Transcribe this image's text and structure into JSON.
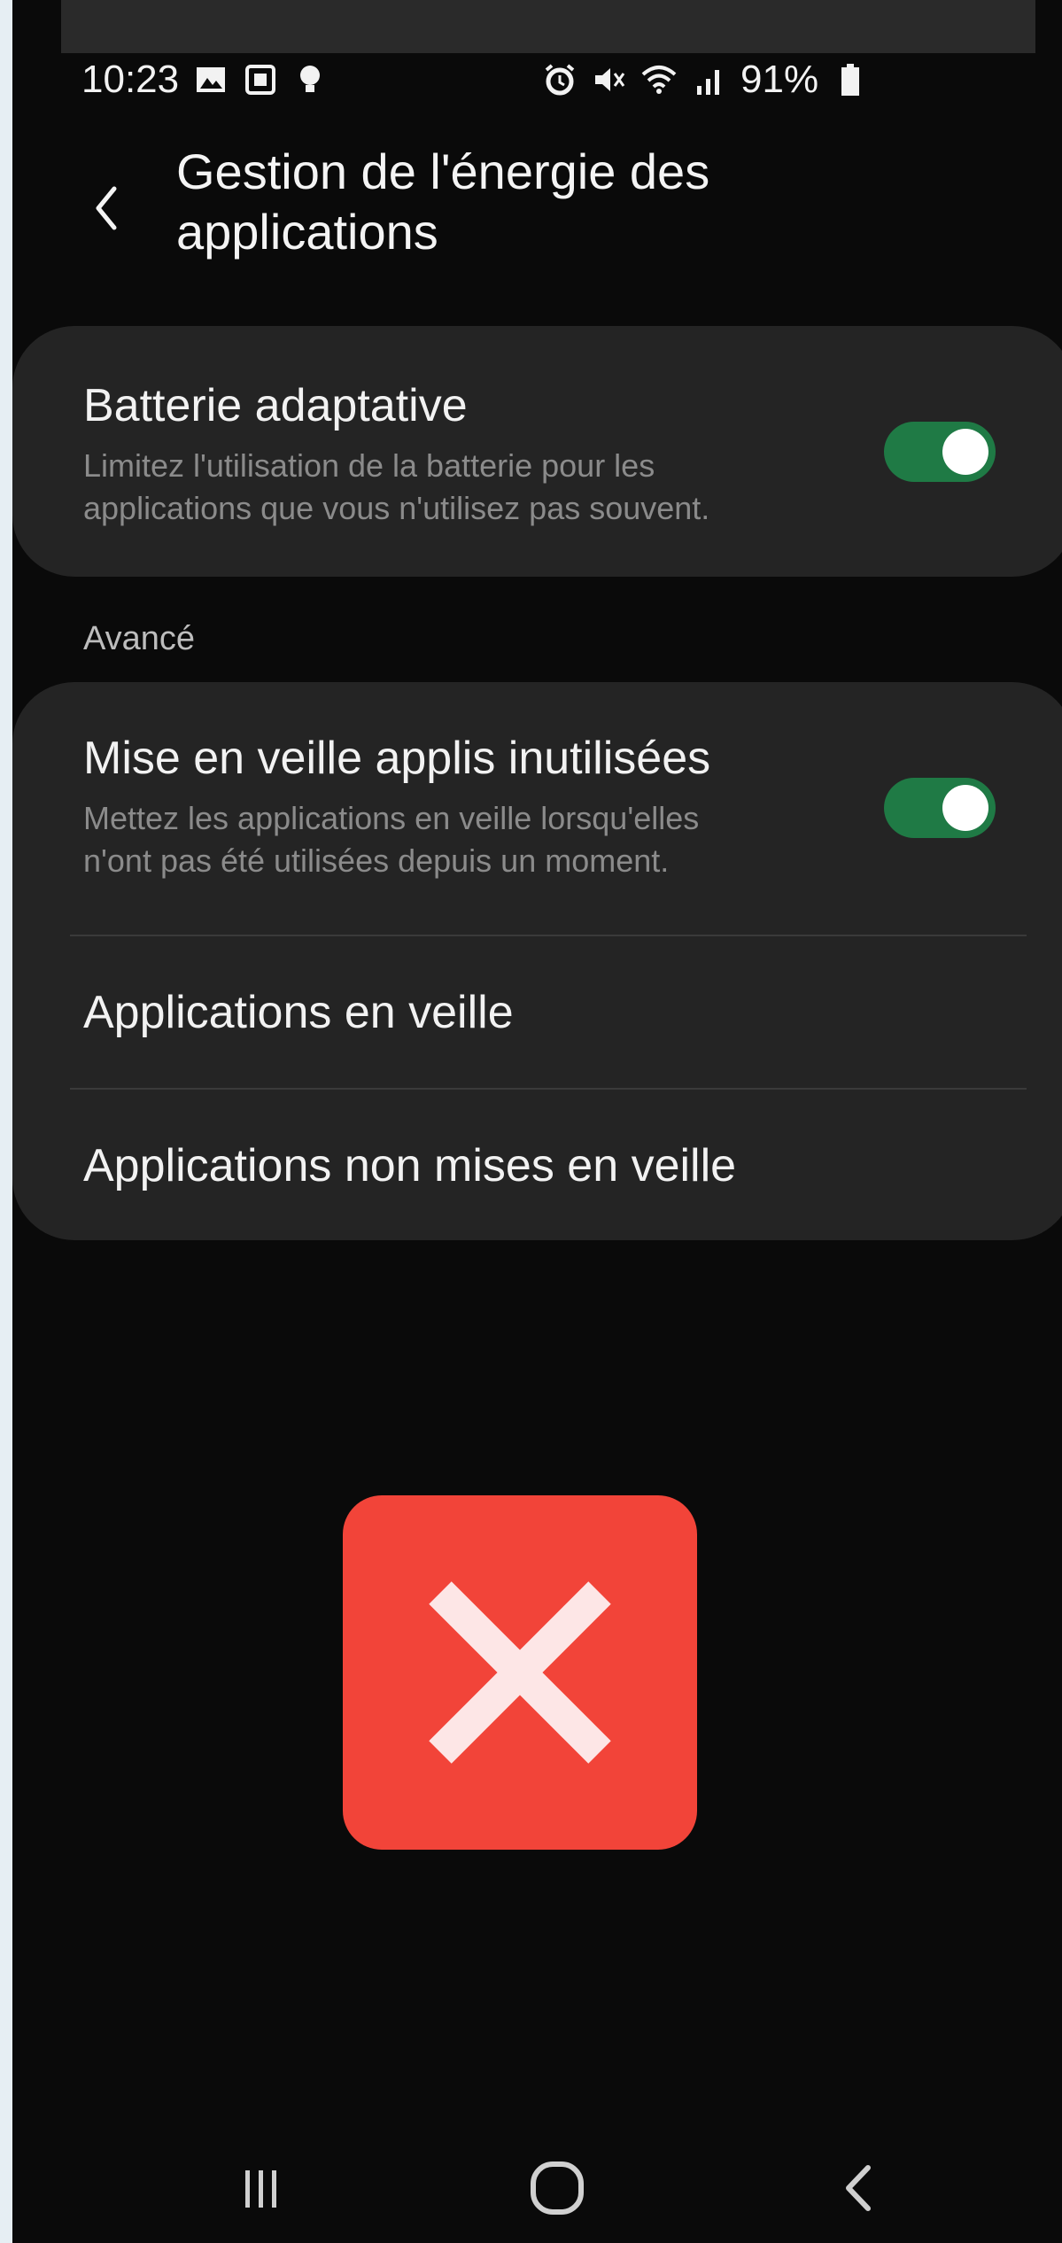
{
  "status_bar": {
    "time": "10:23",
    "battery_percent": "91%",
    "icons": [
      "gallery-icon",
      "screenshot-icon",
      "bulb-icon",
      "alarm-icon",
      "mute-icon",
      "wifi-icon",
      "signal-icon",
      "battery-icon"
    ]
  },
  "header": {
    "title_line1": "Gestion de l'énergie des",
    "title_line2": "applications"
  },
  "adaptive_battery": {
    "title": "Batterie adaptative",
    "subtitle_line1": "Limitez l'utilisation de la batterie pour les",
    "subtitle_line2": "applications que vous n'utilisez pas souvent.",
    "enabled": true
  },
  "advanced": {
    "section_label": "Avancé",
    "sleep_unused": {
      "title": "Mise en veille applis inutilisées",
      "subtitle_line1": "Mettez les applications en veille lorsqu'elles",
      "subtitle_line2": "n'ont pas été utilisées depuis un moment.",
      "enabled": true
    },
    "sleeping_apps": "Applications en veille",
    "never_sleeping_apps": "Applications non mises en veille"
  },
  "overlay": {
    "icon": "close-icon",
    "color": "#f24439"
  },
  "colors": {
    "toggle_on": "#1f7a45",
    "background": "#0a0a0a",
    "card": "#242424"
  }
}
